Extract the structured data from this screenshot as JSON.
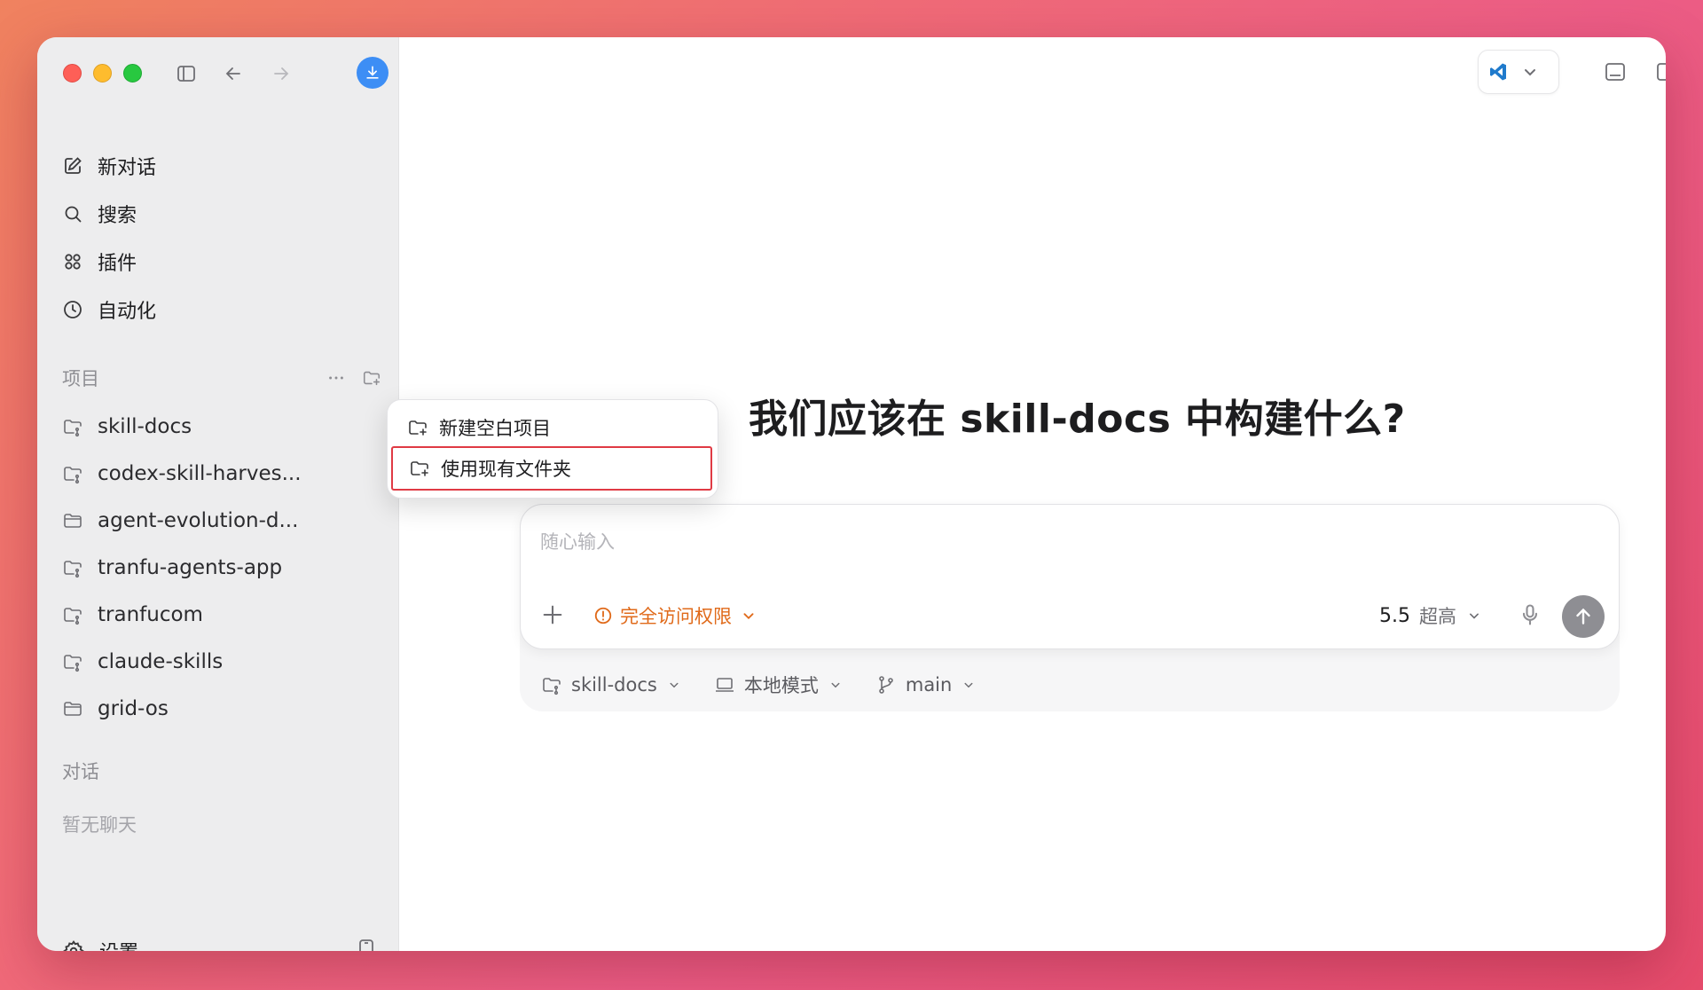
{
  "nav": {
    "new_chat": "新对话",
    "search": "搜索",
    "plugins": "插件",
    "automation": "自动化"
  },
  "projects_section": {
    "title": "项目",
    "items": [
      "skill-docs",
      "codex-skill-harves...",
      "agent-evolution-d...",
      "tranfu-agents-app",
      "tranfucom",
      "claude-skills",
      "grid-os"
    ]
  },
  "conversations_section": {
    "title": "对话",
    "empty_text": "暂无聊天"
  },
  "settings_label": "设置",
  "project_menu": {
    "new_blank_project": "新建空白项目",
    "use_existing_folder": "使用现有文件夹"
  },
  "main": {
    "headline": "我们应该在 skill-docs 中构建什么?"
  },
  "composer": {
    "placeholder": "随心输入",
    "access_label": "完全访问权限",
    "model_version": "5.5",
    "model_level": "超高"
  },
  "meta_bar": {
    "project": "skill-docs",
    "mode": "本地模式",
    "branch": "main"
  },
  "colors": {
    "accent_blue": "#3d8ef5",
    "access_orange": "#e06a1a",
    "highlight_red": "#e03a44"
  }
}
